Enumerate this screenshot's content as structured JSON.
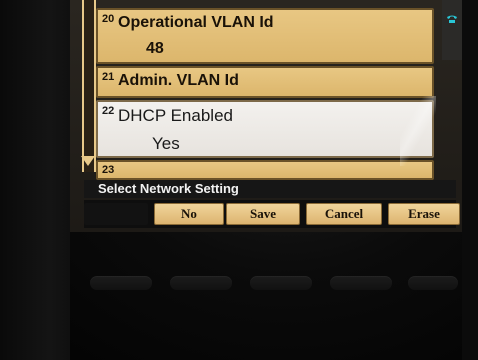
{
  "list": {
    "rows": [
      {
        "number": "20",
        "label": "Operational VLAN Id",
        "value": "48"
      },
      {
        "number": "21",
        "label": "Admin. VLAN Id",
        "value": ""
      },
      {
        "number": "22",
        "label": "DHCP Enabled",
        "value": "Yes"
      },
      {
        "number": "23",
        "label": "",
        "value": ""
      }
    ]
  },
  "prompt": "Select Network Setting",
  "softkeys": {
    "no": "No",
    "save": "Save",
    "cancel": "Cancel",
    "erase": "Erase"
  },
  "icons": {
    "status": "phone-handset-icon",
    "scroll": "scroll-down-arrow-icon"
  },
  "colors": {
    "row_bg": "#dcb66c",
    "row_selected_bg": "#eeebe6",
    "softkey_bg": "#ecc88a",
    "status_icon": "#29c6d6"
  }
}
